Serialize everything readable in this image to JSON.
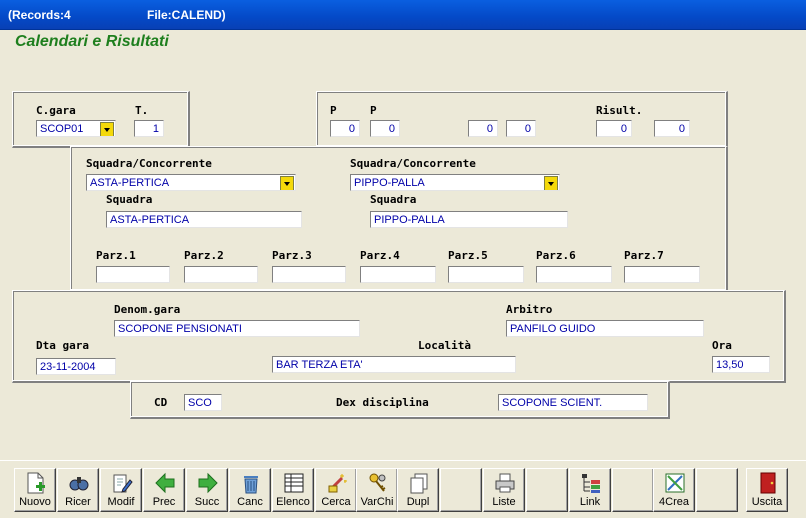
{
  "window": {
    "records": "(Records:4",
    "file": "File:CALEND)"
  },
  "app_title": "Calendari e Risultati",
  "labels": {
    "cgara": "C.gara",
    "t": "T.",
    "p1": "P",
    "p2": "P",
    "risult": "Risult.",
    "squadra_conc_1": "Squadra/Concorrente",
    "squadra_conc_2": "Squadra/Concorrente",
    "squadra_1": "Squadra",
    "squadra_2": "Squadra",
    "parz": [
      "Parz.1",
      "Parz.2",
      "Parz.3",
      "Parz.4",
      "Parz.5",
      "Parz.6",
      "Parz.7"
    ],
    "denom_gara": "Denom.gara",
    "arbitro": "Arbitro",
    "dta_gara": "Dta gara",
    "localita": "Località",
    "ora": "Ora",
    "cd": "CD",
    "dex_disciplina": "Dex disciplina"
  },
  "fields": {
    "cgara": "SCOP01",
    "t": "1",
    "p1": "0",
    "p2": "0",
    "p3": "0",
    "p4": "0",
    "risult1": "0",
    "risult2": "0",
    "squadra_conc_1": "ASTA-PERTICA",
    "squadra_conc_2": "PIPPO-PALLA",
    "squadra_1": "ASTA-PERTICA",
    "squadra_2": "PIPPO-PALLA",
    "parz": [
      "",
      "",
      "",
      "",
      "",
      "",
      ""
    ],
    "denom_gara": "SCOPONE PENSIONATI",
    "arbitro": "PANFILO GUIDO",
    "dta_gara": "23-11-2004",
    "localita": "BAR TERZA ETA'",
    "ora": "13,50",
    "cd": "SCO",
    "dex_disciplina": "SCOPONE SCIENT."
  },
  "toolbar": {
    "nuovo": "Nuovo",
    "ricer": "Ricer",
    "modif": "Modif",
    "prec": "Prec",
    "succ": "Succ",
    "canc": "Canc",
    "elenco": "Elenco",
    "cerca": "Cerca",
    "varchi": "VarChi",
    "dupl": "Dupl",
    "liste": "Liste",
    "link": "Link",
    "crea": "4Crea",
    "uscita": "Uscita"
  },
  "colors": {
    "title_green": "#1E7F1E",
    "field_text": "#0000A8",
    "dropdown": "#F4D90A",
    "face": "#ECE9D8"
  }
}
